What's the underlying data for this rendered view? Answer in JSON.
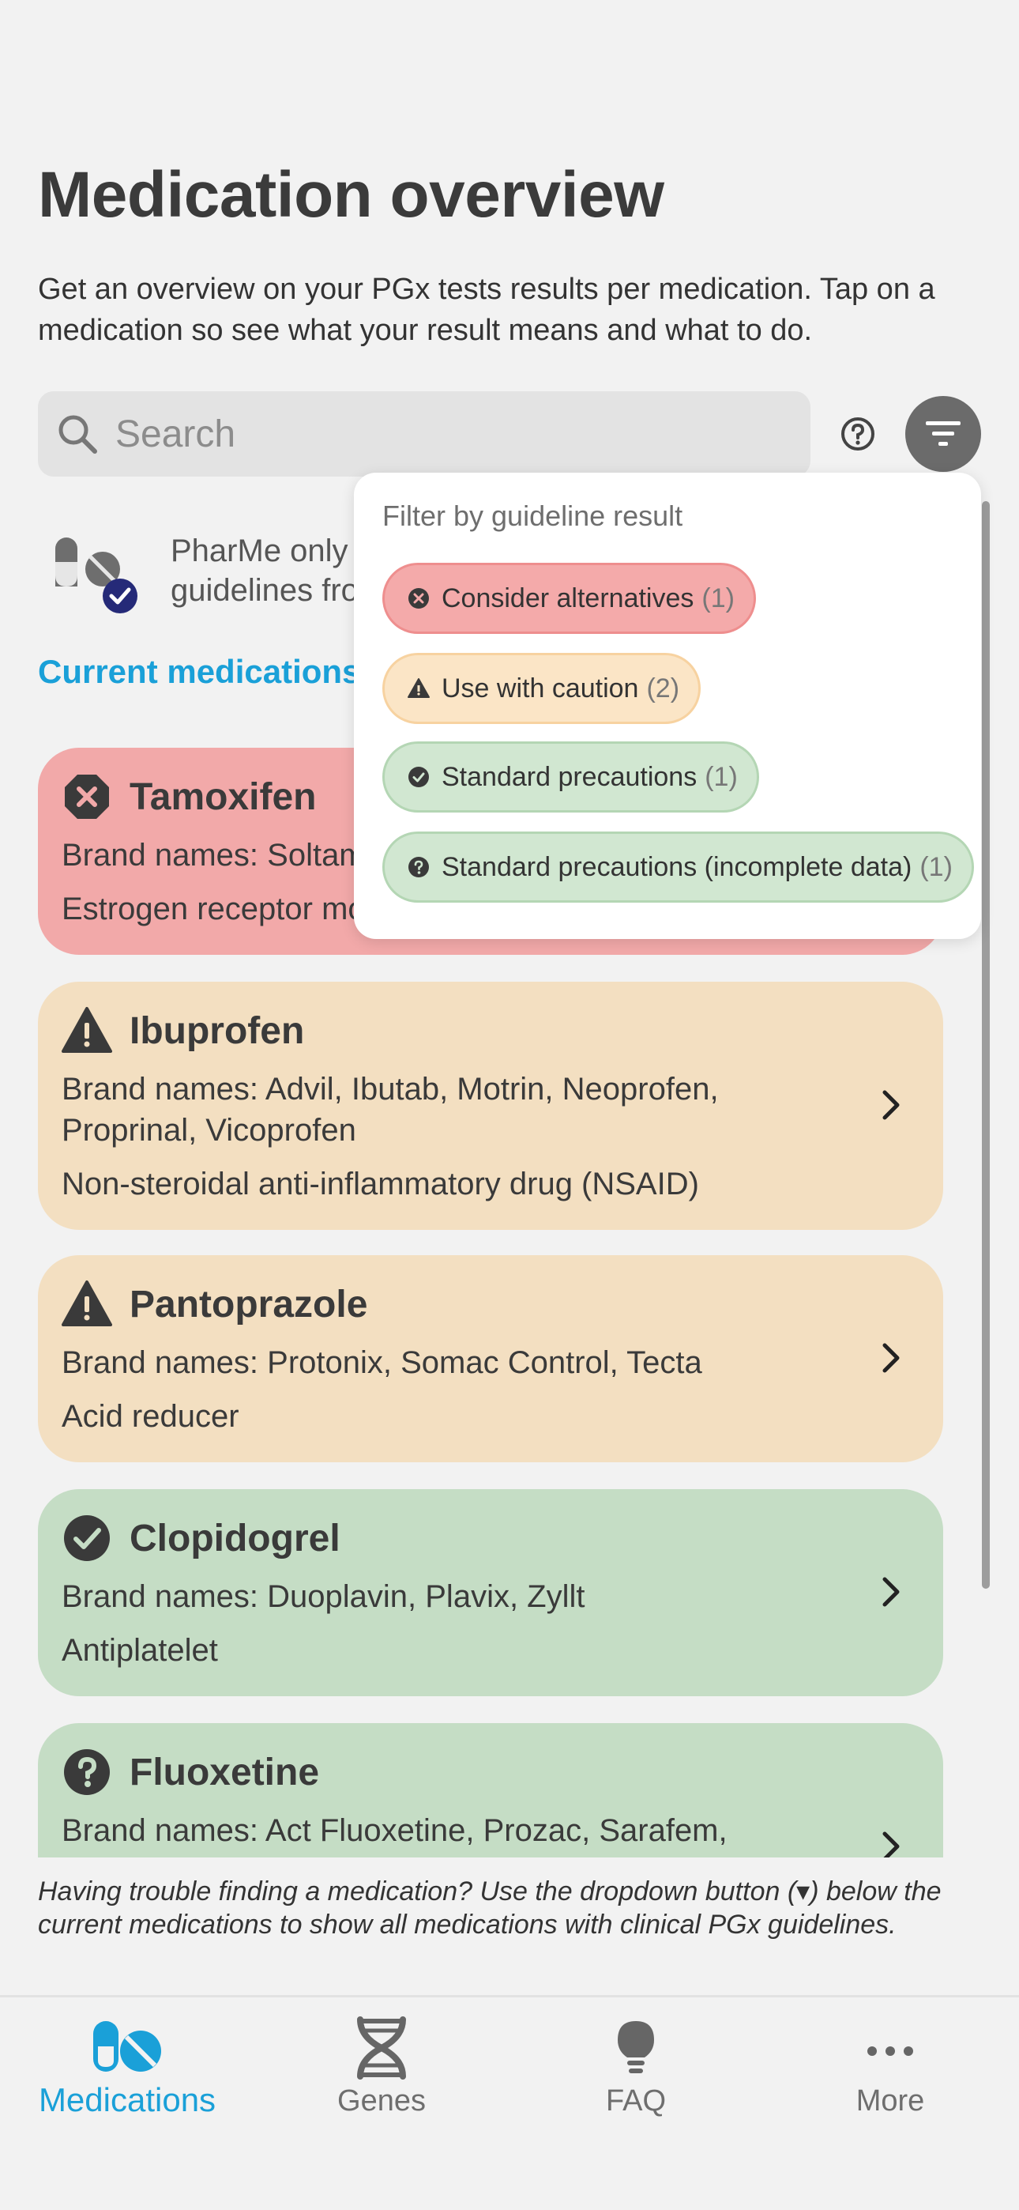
{
  "header": {
    "title": "Medication overview",
    "description": "Get an overview on your PGx tests results per medication. Tap on a medication so see what your result means and what to do."
  },
  "search": {
    "placeholder": "Search"
  },
  "info": {
    "text": "PharMe only shows medications with clinical PGx guidelines from..."
  },
  "section": {
    "label": "Current medications"
  },
  "medications": [
    {
      "name": "Tamoxifen",
      "brand": "Brand names: Soltamox, Nolvadex",
      "class": "Estrogen receptor modulator",
      "status": "consider-alternatives",
      "color": "#f2a9a9"
    },
    {
      "name": "Ibuprofen",
      "brand": "Brand names: Advil, Ibutab, Motrin, Neoprofen, Proprinal, Vicoprofen",
      "class": "Non-steroidal anti-inflammatory drug (NSAID)",
      "status": "use-with-caution",
      "color": "#f3dfc1"
    },
    {
      "name": "Pantoprazole",
      "brand": "Brand names: Protonix, Somac Control, Tecta",
      "class": "Acid reducer",
      "status": "use-with-caution",
      "color": "#f3dfc1"
    },
    {
      "name": "Clopidogrel",
      "brand": "Brand names: Duoplavin, Plavix, Zyllt",
      "class": "Antiplatelet",
      "status": "standard-precautions",
      "color": "#c5ddc5"
    },
    {
      "name": "Fluoxetine",
      "brand": "Brand names: Act Fluoxetine, Prozac, Sarafem,",
      "class": "",
      "status": "standard-precautions-incomplete",
      "color": "#c5ddc5"
    }
  ],
  "filter": {
    "title": "Filter by guideline result",
    "options": [
      {
        "label": "Consider alternatives",
        "count": "(1)"
      },
      {
        "label": "Use with caution",
        "count": "(2)"
      },
      {
        "label": "Standard precautions",
        "count": "(1)"
      },
      {
        "label": "Standard precautions (incomplete data)",
        "count": "(1)"
      }
    ]
  },
  "hint": {
    "text": "Having trouble finding a medication? Use the dropdown button (▾) below the current medications to show all medications with clinical PGx guidelines."
  },
  "nav": {
    "items": [
      {
        "label": "Medications",
        "icon": "pills-icon",
        "active": true
      },
      {
        "label": "Genes",
        "icon": "dna-icon",
        "active": false
      },
      {
        "label": "FAQ",
        "icon": "lightbulb-icon",
        "active": false
      },
      {
        "label": "More",
        "icon": "more-icon",
        "active": false
      }
    ]
  },
  "colors": {
    "accent": "#1aa0d8",
    "red": "#f2a9a9",
    "orange": "#f3dfc1",
    "green": "#c5ddc5"
  }
}
